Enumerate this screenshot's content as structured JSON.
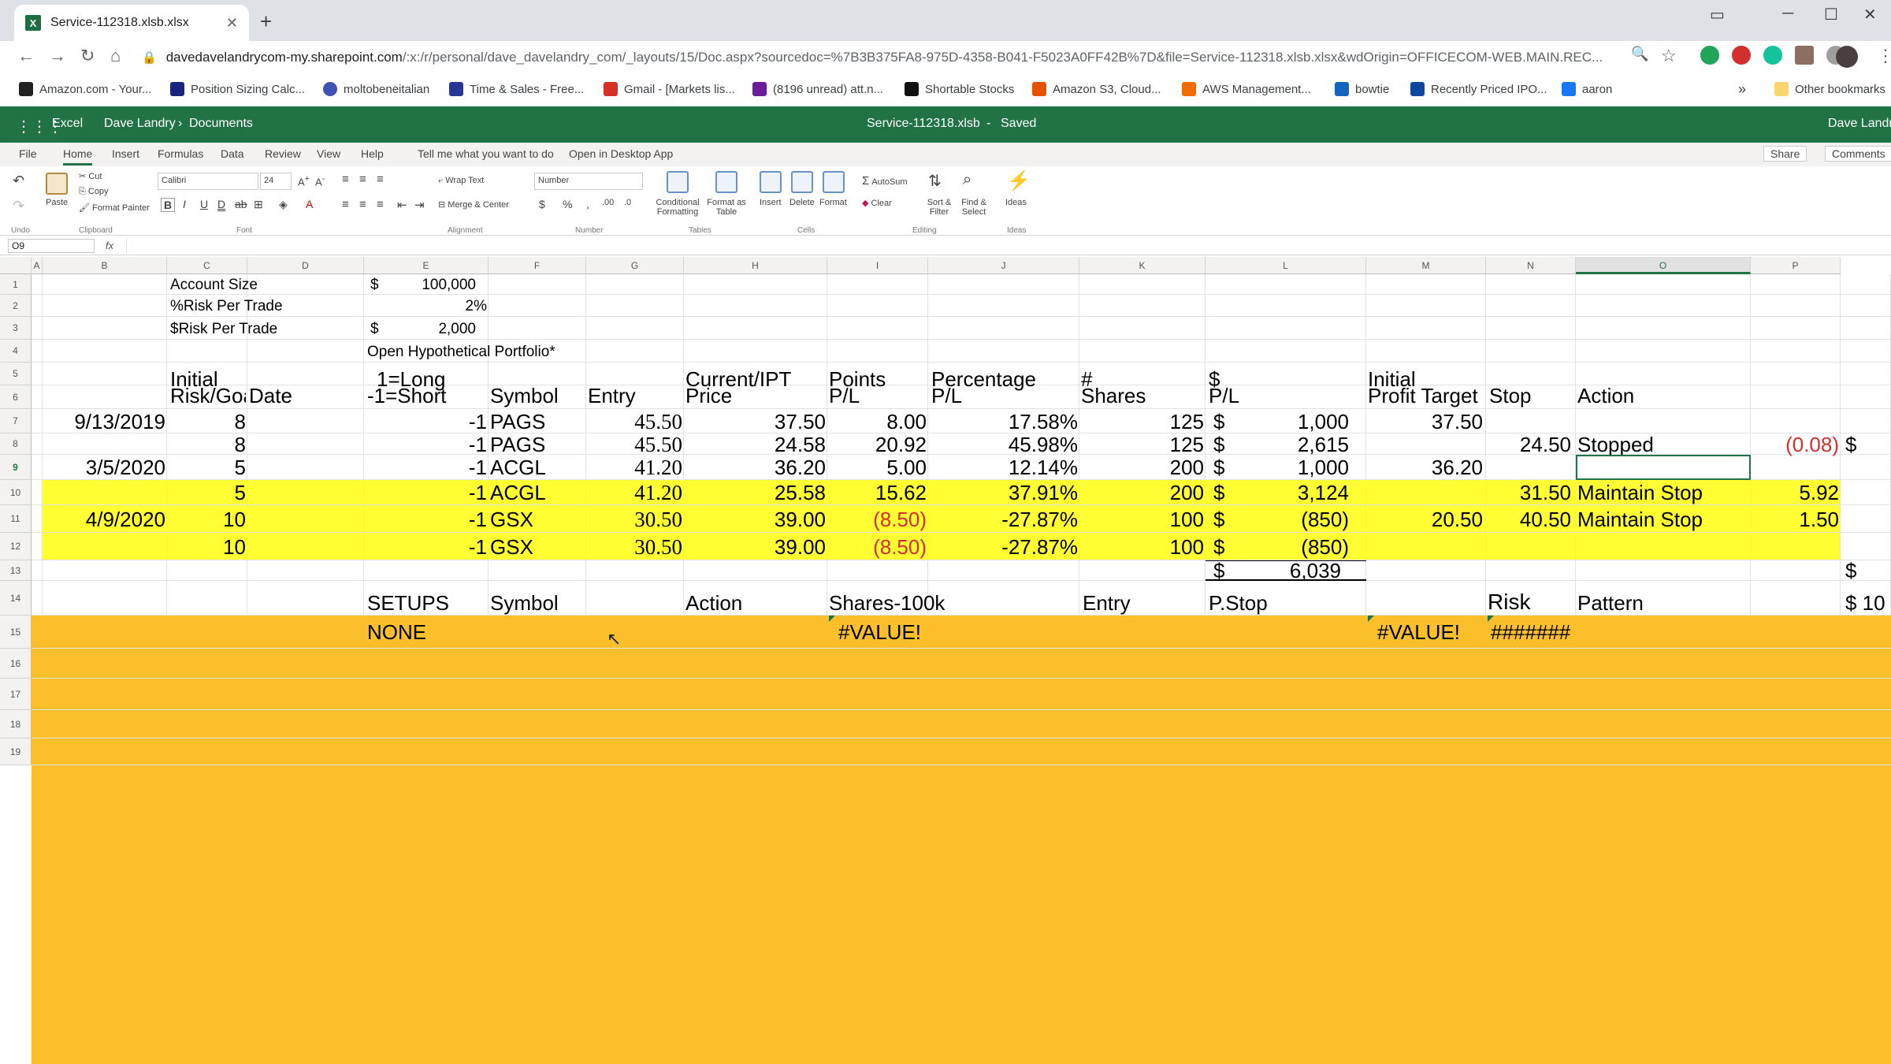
{
  "browser": {
    "tab_title": "Service-112318.xlsb.xlsx",
    "url_domain": "davedavelandrycom-my.sharepoint.com",
    "url_path": "/:x:/r/personal/dave_davelandry_com/_layouts/15/Doc.aspx?sourcedoc=%7B3B375FA8-975D-4358-B041-F5023A0FF42B%7D&file=Service-112318.xlsb.xlsx&wdOrigin=OFFICECOM-WEB.MAIN.REC...",
    "bookmarks": [
      "Amazon.com - Your...",
      "Position Sizing Calc...",
      "moltobeneitalian",
      "Time & Sales - Free...",
      "Gmail - [Markets lis...",
      "(8196 unread) att.n...",
      "Shortable Stocks",
      "Amazon S3, Cloud...",
      "AWS Management...",
      "bowtie",
      "Recently Priced IPO...",
      "aaron"
    ],
    "other_bookmarks": "Other bookmarks",
    "more_bookmarks": "»"
  },
  "excel": {
    "app": "Excel",
    "breadcrumb_user": "Dave Landry",
    "breadcrumb_folder": "Documents",
    "file": "Service-112318.xlsb",
    "status": "Saved",
    "user": "Dave Landry",
    "tabs": [
      "File",
      "Home",
      "Insert",
      "Formulas",
      "Data",
      "Review",
      "View",
      "Help"
    ],
    "tell_me": "Tell me what you want to do",
    "open_desktop": "Open in Desktop App",
    "share": "Share",
    "comments": "Comments",
    "name_box": "O9",
    "fx": "fx",
    "font_name": "Calibri",
    "font_size": "24",
    "number_format": "Number",
    "ribbon": {
      "undo": "Undo",
      "paste": "Paste",
      "cut": "Cut",
      "copy": "Copy",
      "format_painter": "Format Painter",
      "clipboard": "Clipboard",
      "font": "Font",
      "wrap_text": "Wrap Text",
      "merge_center": "Merge & Center",
      "alignment": "Alignment",
      "number": "Number",
      "conditional_formatting": "Conditional Formatting",
      "format_as_table": "Format as Table",
      "tables": "Tables",
      "insert": "Insert",
      "delete": "Delete",
      "format": "Format",
      "cells": "Cells",
      "autosum": "AutoSum",
      "clear": "Clear",
      "sort_filter": "Sort & Filter",
      "find_select": "Find & Select",
      "editing": "Editing",
      "ideas": "Ideas",
      "ideas_group": "Ideas"
    }
  },
  "sheet": {
    "columns": [
      "A",
      "B",
      "C",
      "D",
      "E",
      "F",
      "G",
      "H",
      "I",
      "J",
      "K",
      "L",
      "M",
      "N",
      "O",
      "P"
    ],
    "rows": [
      "1",
      "2",
      "3",
      "4",
      "5",
      "6",
      "7",
      "8",
      "9",
      "10",
      "11",
      "12",
      "13",
      "14",
      "15",
      "16",
      "17",
      "18",
      "19"
    ],
    "account_size_label": "Account Size",
    "account_size_cur": "$",
    "account_size": "100,000",
    "risk_pct_label": "%Risk Per Trade",
    "risk_pct": "2%",
    "risk_dollar_label": "$Risk Per Trade",
    "risk_dollar_cur": "$",
    "risk_dollar": "2,000",
    "portfolio_title": "Open Hypothetical Portfolio*",
    "headers": {
      "c5": "Initial",
      "c6": "Risk/Goa",
      "d6": "Date",
      "e5": "1=Long",
      "e6": "-1=Short",
      "f6": "Symbol",
      "g6": "Entry",
      "h5": "Current/IPT",
      "h6": "Price",
      "i5": "Points",
      "i6": "P/L",
      "j5": "Percentage",
      "j6": "P/L",
      "k5": "#",
      "k6": "Shares",
      "l5": "$",
      "l6": "P/L",
      "m5": "Initial",
      "m6": "Profit Target",
      "n6": "Stop",
      "o6": "Action"
    },
    "trades": [
      {
        "date": "9/13/2019",
        "risk": "8",
        "dir": "-1",
        "symbol": "PAGS",
        "entry": "45.50",
        "price": "37.50",
        "points": "8.00",
        "pct": "17.58%",
        "shares": "125",
        "cur": "$",
        "pl": "1,000",
        "target": "37.50",
        "stop": "",
        "action": "",
        "extra": ""
      },
      {
        "date": "",
        "risk": "8",
        "dir": "-1",
        "symbol": "PAGS",
        "entry": "45.50",
        "price": "24.58",
        "points": "20.92",
        "pct": "45.98%",
        "shares": "125",
        "cur": "$",
        "pl": "2,615",
        "target": "",
        "stop": "24.50",
        "action": "Stopped",
        "extra": "(0.08)"
      },
      {
        "date": "3/5/2020",
        "risk": "5",
        "dir": "-1",
        "symbol": "ACGL",
        "entry": "41.20",
        "price": "36.20",
        "points": "5.00",
        "pct": "12.14%",
        "shares": "200",
        "cur": "$",
        "pl": "1,000",
        "target": "36.20",
        "stop": "",
        "action": "",
        "extra": ""
      },
      {
        "date": "",
        "risk": "5",
        "dir": "-1",
        "symbol": "ACGL",
        "entry": "41.20",
        "price": "25.58",
        "points": "15.62",
        "pct": "37.91%",
        "shares": "200",
        "cur": "$",
        "pl": "3,124",
        "target": "",
        "stop": "31.50",
        "action": "Maintain Stop",
        "extra": "5.92"
      },
      {
        "date": "4/9/2020",
        "risk": "10",
        "dir": "-1",
        "symbol": "GSX",
        "entry": "30.50",
        "price": "39.00",
        "points": "(8.50)",
        "pct": "-27.87%",
        "shares": "100",
        "cur": "$",
        "pl": "(850)",
        "target": "20.50",
        "stop": "40.50",
        "action": "Maintain Stop",
        "extra": "1.50"
      },
      {
        "date": "",
        "risk": "10",
        "dir": "-1",
        "symbol": "GSX",
        "entry": "30.50",
        "price": "39.00",
        "points": "(8.50)",
        "pct": "-27.87%",
        "shares": "100",
        "cur": "$",
        "pl": "(850)",
        "target": "",
        "stop": "",
        "action": "",
        "extra": ""
      }
    ],
    "p8_dollar": "$",
    "total_cur": "$",
    "total": "6,039",
    "p13": "$",
    "setups": {
      "setups": "SETUPS",
      "symbol": "Symbol",
      "action": "Action",
      "shares": "Shares-100k",
      "entry": "Entry",
      "pstop": "P.Stop",
      "risk": "Risk",
      "pattern": "Pattern",
      "p14": "$ 10"
    },
    "row15": {
      "none": "NONE",
      "value1": "#VALUE!",
      "value2": "#VALUE!",
      "hash": "#######"
    }
  }
}
